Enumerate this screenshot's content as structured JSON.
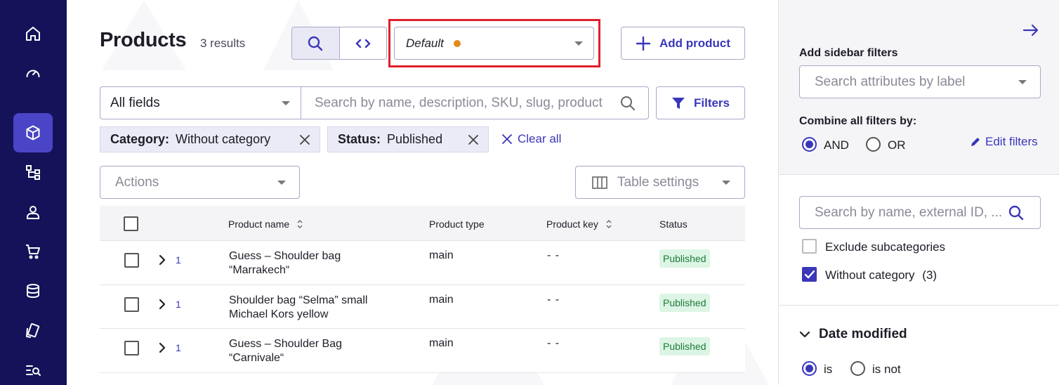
{
  "nav": {
    "items": [
      {
        "name": "home-icon",
        "active": false
      },
      {
        "name": "dashboard-icon",
        "active": false
      },
      {
        "name": "products-icon",
        "active": true
      },
      {
        "name": "categories-icon",
        "active": false
      },
      {
        "name": "customers-icon",
        "active": false
      },
      {
        "name": "orders-icon",
        "active": false
      },
      {
        "name": "discounts-icon",
        "active": false
      },
      {
        "name": "project-settings-icon",
        "active": false
      },
      {
        "name": "search-list-icon",
        "active": false
      }
    ]
  },
  "header": {
    "title": "Products",
    "results": "3 results",
    "view_name": "Default",
    "add_product": "Add product"
  },
  "search": {
    "field_select": "All fields",
    "placeholder": "Search by name, description, SKU, slug, product key",
    "filters_label": "Filters"
  },
  "chips": [
    {
      "key": "Category:",
      "value": "Without category"
    },
    {
      "key": "Status:",
      "value": "Published"
    }
  ],
  "clear_all": "Clear all",
  "actions": {
    "placeholder": "Actions"
  },
  "table_settings": "Table settings",
  "table": {
    "columns": [
      "Product name",
      "Product type",
      "Product key",
      "Status"
    ],
    "rows": [
      {
        "count": "1",
        "name_line1": "Guess – Shoulder bag",
        "name_line2": "“Marrakech“",
        "type": "main",
        "key": "- -",
        "status": "Published"
      },
      {
        "count": "1",
        "name_line1": "Shoulder bag “Selma” small",
        "name_line2": "Michael Kors yellow",
        "type": "main",
        "key": "- -",
        "status": "Published"
      },
      {
        "count": "1",
        "name_line1": "Guess – Shoulder Bag",
        "name_line2": "“Carnivale“",
        "type": "main",
        "key": "- -",
        "status": "Published"
      }
    ]
  },
  "sidebar": {
    "add_filters_label": "Add sidebar filters",
    "attributes_placeholder": "Search attributes by label",
    "combine_label": "Combine all filters by:",
    "and_label": "AND",
    "or_label": "OR",
    "combine_selected": "AND",
    "edit_filters": "Edit filters",
    "category_search_placeholder": "Search by name, external ID, ...",
    "exclude_subcategories": "Exclude subcategories",
    "exclude_checked": false,
    "without_category": "Without category",
    "without_category_count": "(3)",
    "without_category_checked": true,
    "date_modified": "Date modified",
    "is_label": "is",
    "is_not_label": "is not"
  },
  "colors": {
    "rail": "#15125a",
    "rail_active": "#4a45c6",
    "accent": "#3a37b8",
    "highlight": "#e0202e",
    "status_dot": "#e28b16",
    "badge_bg": "#dcf5e4",
    "badge_text": "#1f7a3c"
  }
}
